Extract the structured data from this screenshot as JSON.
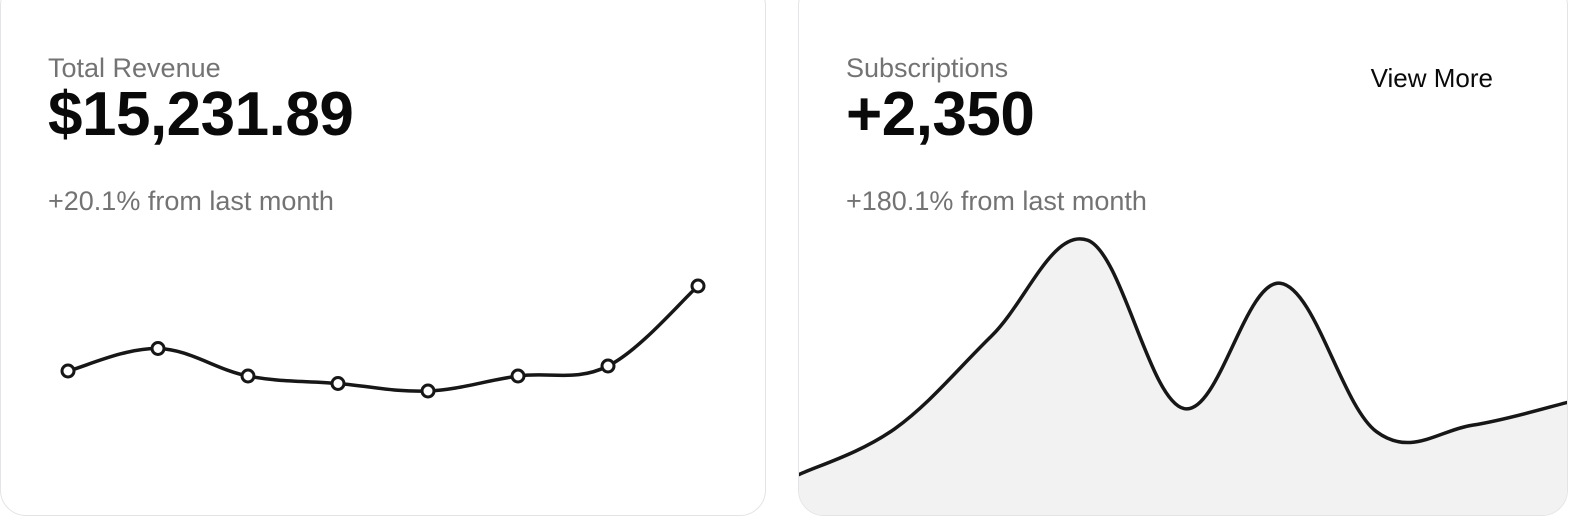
{
  "revenue": {
    "label": "Total Revenue",
    "value": "$15,231.89",
    "delta": "+20.1% from last month"
  },
  "subscriptions": {
    "label": "Subscriptions",
    "value": "+2,350",
    "delta": "+180.1% from last month",
    "view_more_label": "View More"
  },
  "colors": {
    "line": "#171717",
    "area_fill": "#f2f2f2",
    "muted_text": "#737373",
    "border": "#e4e4e7"
  },
  "chart_data": [
    {
      "type": "line",
      "x": [
        1,
        2,
        3,
        4,
        5,
        6,
        7,
        8
      ],
      "values": [
        4.6,
        5.5,
        4.4,
        4.1,
        3.8,
        4.4,
        4.8,
        8.0
      ],
      "ylim": [
        0,
        10
      ],
      "markers": true,
      "grid": false
    },
    {
      "type": "area",
      "x": [
        1,
        2,
        3,
        4,
        5,
        6,
        7,
        8,
        9
      ],
      "values": [
        0.8,
        2.2,
        5.0,
        7.9,
        2.8,
        6.6,
        2.1,
        2.3,
        3.0
      ],
      "ylim": [
        0,
        10
      ],
      "markers": false,
      "grid": false
    }
  ]
}
